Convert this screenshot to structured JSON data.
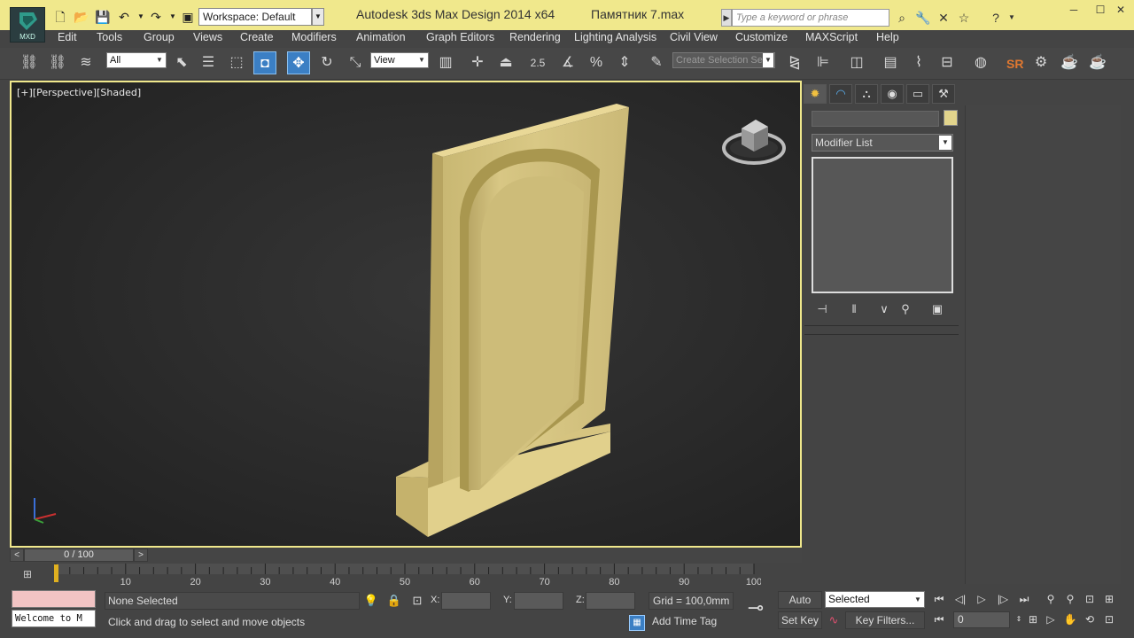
{
  "titlebar": {
    "app_logo_text": "MXD",
    "workspace": "Workspace: Default",
    "app_title": "Autodesk 3ds Max Design 2014 x64",
    "file_title": "Памятник 7.max",
    "search_placeholder": "Type a keyword or phrase"
  },
  "menu": [
    "Edit",
    "Tools",
    "Group",
    "Views",
    "Create",
    "Modifiers",
    "Animation",
    "Graph Editors",
    "Rendering",
    "Lighting Analysis",
    "Civil View",
    "Customize",
    "MAXScript",
    "Help"
  ],
  "toolbar": {
    "selection_filter": "All",
    "reference_coord": "View",
    "snap_angle": "2.5",
    "named_selection_placeholder": "Create Selection Se",
    "sr_label": "SR"
  },
  "viewport": {
    "label_plus": "[+]",
    "label_view": "[Perspective]",
    "label_shading": "[Shaded]",
    "object_color": "#e0d088"
  },
  "command_panel": {
    "modifier_list": "Modifier List",
    "object_color": "#e2d48c"
  },
  "time_slider": {
    "position": "0 / 100",
    "prev": "<",
    "next": ">"
  },
  "track_ticks": [
    "10",
    "20",
    "30",
    "40",
    "50",
    "60",
    "70",
    "80",
    "90",
    "100"
  ],
  "status": {
    "maxscript_output": "Welcome to M",
    "selection": "None Selected",
    "prompt": "Click and drag to select and move objects",
    "x_label": "X:",
    "y_label": "Y:",
    "z_label": "Z:",
    "grid": "Grid = 100,0mm",
    "add_time_tag": "Add Time Tag",
    "auto_key": "Auto Key",
    "set_key": "Set Key",
    "key_mode": "Selected",
    "key_filters": "Key Filters...",
    "current_frame": "0"
  },
  "colors": {
    "accent_titlebar": "#f0e88c",
    "active_tool": "#3b7fc4"
  }
}
